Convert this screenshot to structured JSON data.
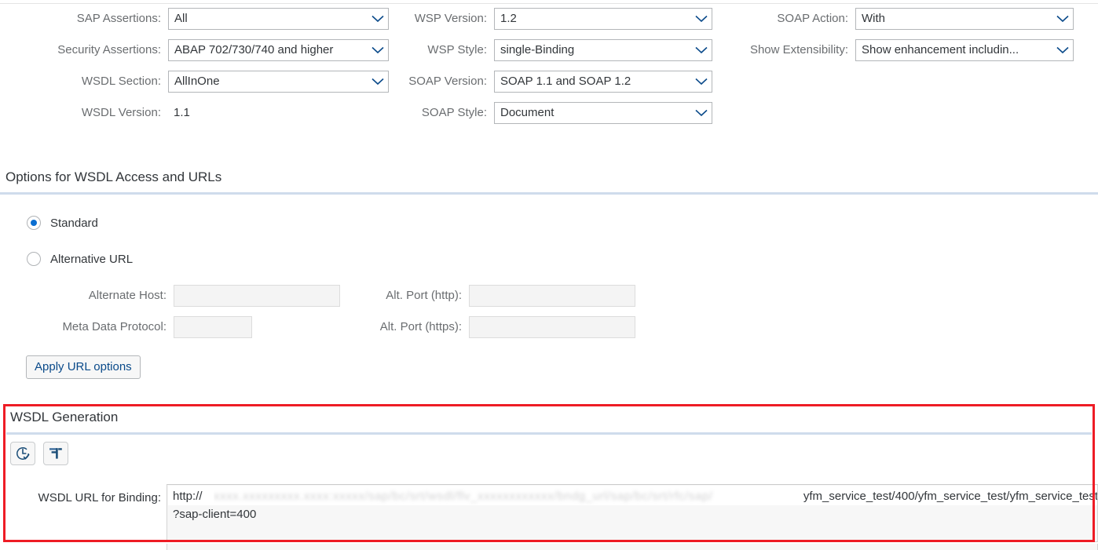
{
  "top_form": {
    "columns": [
      {
        "fields": [
          {
            "label": "SAP Assertions:",
            "type": "select",
            "value": "All"
          },
          {
            "label": "Security Assertions:",
            "type": "select",
            "value": "ABAP 702/730/740 and higher"
          },
          {
            "label": "WSDL Section:",
            "type": "select",
            "value": "AllInOne"
          },
          {
            "label": "WSDL Version:",
            "type": "text",
            "value": "1.1"
          }
        ]
      },
      {
        "fields": [
          {
            "label": "WSP Version:",
            "type": "select",
            "value": "1.2"
          },
          {
            "label": "WSP Style:",
            "type": "select",
            "value": "single-Binding"
          },
          {
            "label": "SOAP Version:",
            "type": "select",
            "value": "SOAP 1.1 and SOAP 1.2"
          },
          {
            "label": "SOAP Style:",
            "type": "select",
            "value": "Document"
          }
        ]
      },
      {
        "fields": [
          {
            "label": "SOAP Action:",
            "type": "select",
            "value": "With"
          },
          {
            "label": "Show Extensibility:",
            "type": "select",
            "value": "Show enhancement includin..."
          }
        ]
      }
    ]
  },
  "url_options": {
    "title": "Options for WSDL Access and URLs",
    "radios": [
      {
        "label": "Standard",
        "selected": true
      },
      {
        "label": "Alternative URL",
        "selected": false
      }
    ],
    "fields": [
      {
        "label": "Alternate Host:",
        "value": ""
      },
      {
        "label": "Meta Data Protocol:",
        "value": ""
      },
      {
        "label": "Alt. Port (http):",
        "value": ""
      },
      {
        "label": "Alt. Port (https):",
        "value": ""
      }
    ],
    "apply_button": "Apply URL options"
  },
  "wsdl_generation": {
    "title": "WSDL Generation",
    "toolbar": [
      {
        "name": "clock-check-icon",
        "tooltip": "clock-check-icon"
      },
      {
        "name": "filter-icon",
        "tooltip": "filter-icon"
      }
    ],
    "url_field": {
      "label": "WSDL URL for Binding:",
      "value_head": "http://",
      "value_redacted": "xxxx.xxxxxxxxx.xxxx:xxxxx/sap/bc/srt/wsdl/flv_xxxxxxxxxxxx/bndg_url/sap/bc/srt/rfc/sap/",
      "value_tail": "yfm_service_test/400/yfm_service_test/yfm_service_test",
      "value_line2": "?sap-client=400"
    }
  },
  "colors": {
    "accent_blue": "#0a6ed1",
    "link_blue": "#0a4a8a",
    "highlight_red": "#ee1c25",
    "label_grey": "#6a6d70",
    "section_rule": "#cfdcec",
    "icon_navy": "#1d4f79"
  }
}
